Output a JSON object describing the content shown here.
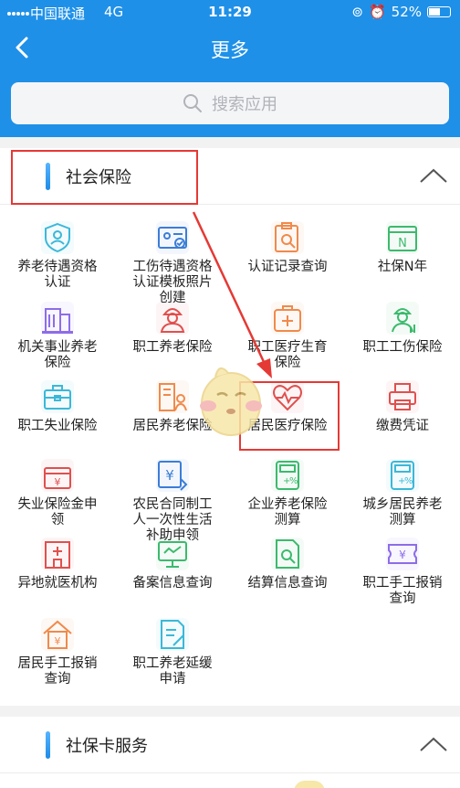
{
  "status": {
    "carrier": "中国联通",
    "network": "4G",
    "time": "11:29",
    "battery": "52%"
  },
  "nav": {
    "title": "更多"
  },
  "search": {
    "placeholder": "搜索应用"
  },
  "sections": [
    {
      "title": "社会保险"
    },
    {
      "title": "社保卡服务"
    }
  ],
  "items": [
    {
      "label": "养老待遇资格\n认证",
      "icon": "shield-person-icon",
      "color": "#3bb8d8"
    },
    {
      "label": "工伤待遇资格\n认证模板照片\n创建",
      "icon": "id-card-icon",
      "color": "#3b7dd8"
    },
    {
      "label": "认证记录查询",
      "icon": "clipboard-search-icon",
      "color": "#f08a4b"
    },
    {
      "label": "社保N年",
      "icon": "calendar-n-icon",
      "color": "#3cba6e"
    },
    {
      "label": "机关事业养老\n保险",
      "icon": "building-icon",
      "color": "#8d6de8"
    },
    {
      "label": "职工养老保险",
      "icon": "worker-icon",
      "color": "#e0504f"
    },
    {
      "label": "职工医疗生育\n保险",
      "icon": "medical-kit-icon",
      "color": "#f08a4b"
    },
    {
      "label": "职工工伤保险",
      "icon": "injured-worker-icon",
      "color": "#3cba6e"
    },
    {
      "label": "职工失业保险",
      "icon": "briefcase-icon",
      "color": "#3bb8d8"
    },
    {
      "label": "居民养老保险",
      "icon": "building-person-icon",
      "color": "#f08a4b"
    },
    {
      "label": "居民医疗保险",
      "icon": "heartbeat-icon",
      "color": "#e0504f"
    },
    {
      "label": "缴费凭证",
      "icon": "printer-icon",
      "color": "#e0504f"
    },
    {
      "label": "失业保险金申\n领",
      "icon": "money-box-icon",
      "color": "#e0504f"
    },
    {
      "label": "农民合同制工\n人一次性生活\n补助申领",
      "icon": "yuan-transfer-icon",
      "color": "#3b7dd8"
    },
    {
      "label": "企业养老保险\n测算",
      "icon": "calculator-icon",
      "color": "#3cba6e"
    },
    {
      "label": "城乡居民养老\n测算",
      "icon": "calculator-icon",
      "color": "#3bb8d8"
    },
    {
      "label": "异地就医机构",
      "icon": "hospital-icon",
      "color": "#e0504f"
    },
    {
      "label": "备案信息查询",
      "icon": "monitor-icon",
      "color": "#3cba6e"
    },
    {
      "label": "结算信息查询",
      "icon": "document-search-icon",
      "color": "#3cba6e"
    },
    {
      "label": "职工手工报销\n查询",
      "icon": "ticket-yuan-icon",
      "color": "#8d6de8"
    },
    {
      "label": "居民手工报销\n查询",
      "icon": "house-yuan-icon",
      "color": "#f08a4b"
    },
    {
      "label": "职工养老延缓\n申请",
      "icon": "document-edit-icon",
      "color": "#3bb8d8"
    }
  ]
}
